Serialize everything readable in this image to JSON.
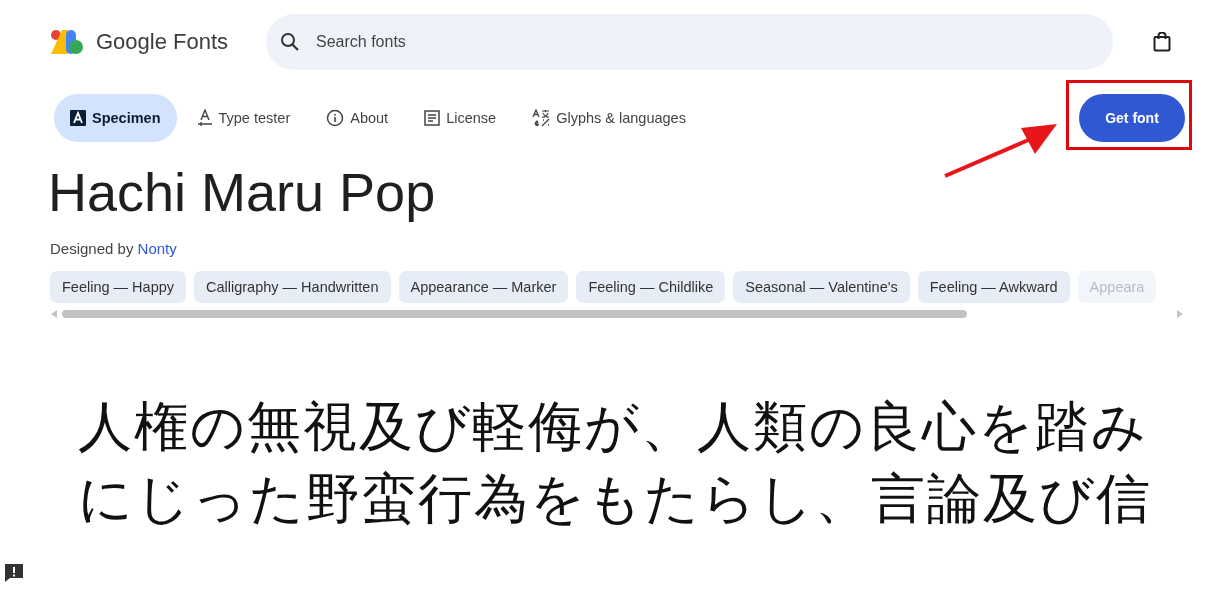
{
  "header": {
    "logo_text": "Google Fonts",
    "search": {
      "placeholder": "Search fonts"
    }
  },
  "tabs": [
    {
      "label": "Specimen",
      "kind": "specimen",
      "selected": true
    },
    {
      "label": "Type tester",
      "kind": "tester",
      "selected": false
    },
    {
      "label": "About",
      "kind": "about",
      "selected": false
    },
    {
      "label": "License",
      "kind": "license",
      "selected": false
    },
    {
      "label": "Glyphs & languages",
      "kind": "glyphs",
      "selected": false
    }
  ],
  "get_font_button": "Get font",
  "font": {
    "name": "Hachi Maru Pop",
    "designed_by": "Designed by",
    "designer": "Nonty"
  },
  "tags": [
    {
      "label": "Feeling — Happy",
      "faded": false
    },
    {
      "label": "Calligraphy — Handwritten",
      "faded": false
    },
    {
      "label": "Appearance — Marker",
      "faded": false
    },
    {
      "label": "Feeling — Childlike",
      "faded": false
    },
    {
      "label": "Seasonal — Valentine's",
      "faded": false
    },
    {
      "label": "Feeling — Awkward",
      "faded": false
    },
    {
      "label": "Appeara",
      "faded": true
    }
  ],
  "sample_lines": [
    "人権の無視及び軽侮が、人類の良心を踏み",
    "にじった野蛮行為をもたらし、言論及び信"
  ]
}
